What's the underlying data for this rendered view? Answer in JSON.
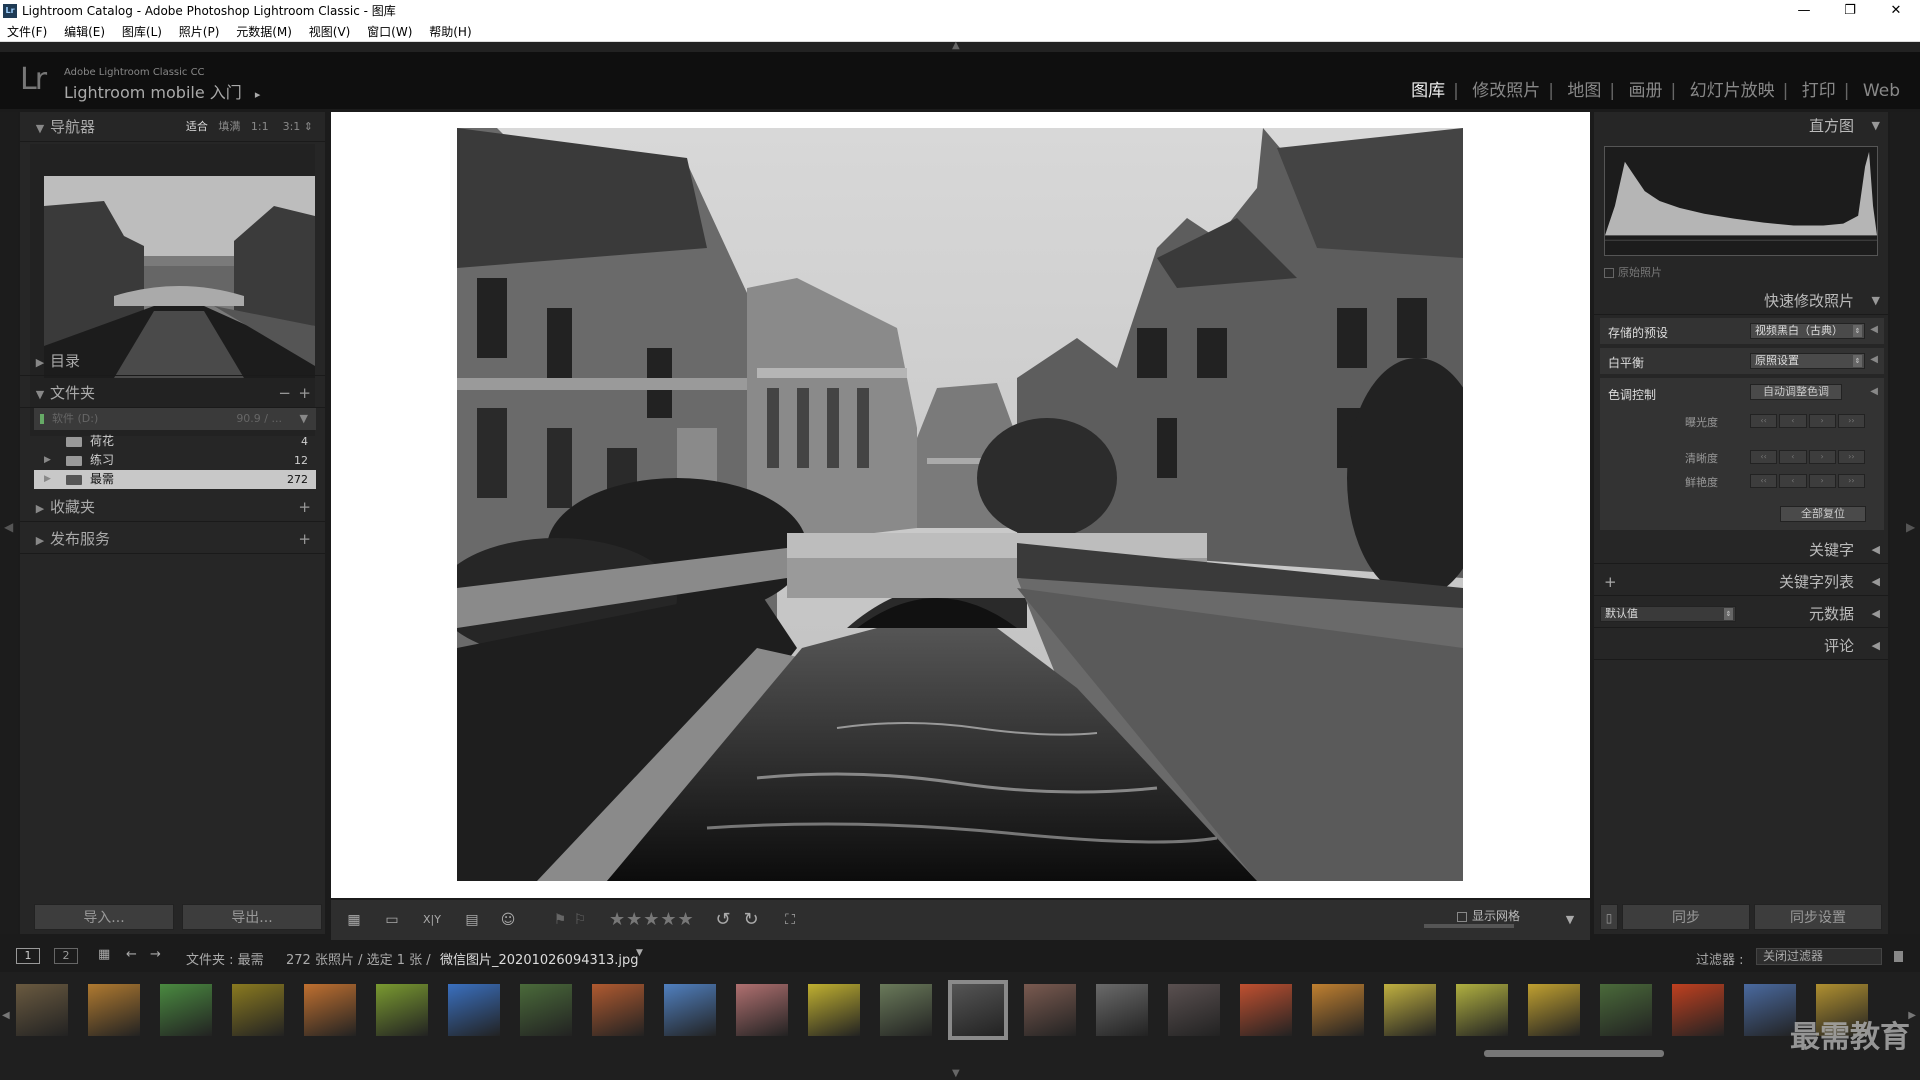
{
  "window": {
    "title": "Lightroom Catalog - Adobe Photoshop Lightroom Classic - 图库",
    "minimize": "—",
    "maximize": "❐",
    "close": "✕"
  },
  "menu": [
    "文件(F)",
    "编辑(E)",
    "图库(L)",
    "照片(P)",
    "元数据(M)",
    "视图(V)",
    "窗口(W)",
    "帮助(H)"
  ],
  "identity": {
    "logo": "Lr",
    "product": "Adobe Lightroom Classic CC",
    "mobile": "Lightroom mobile 入门",
    "arrow": "▸"
  },
  "modules": [
    "图库",
    "修改照片",
    "地图",
    "画册",
    "幻灯片放映",
    "打印",
    "Web"
  ],
  "modules_sep": "|",
  "left": {
    "navigator": {
      "title": "导航器",
      "options": [
        "适合",
        "填满",
        "1:1",
        "3:1"
      ],
      "spin": "⇕"
    },
    "catalog": "目录",
    "folders": {
      "title": "文件夹",
      "minus": "−",
      "plus": "+",
      "volume": "软件 (D:)",
      "volume_size": "90.9 / ...",
      "items": [
        {
          "name": "荷花",
          "count": "4"
        },
        {
          "name": "练习",
          "count": "12"
        },
        {
          "name": "最需",
          "count": "272"
        }
      ]
    },
    "collections": "收藏夹",
    "publish": "发布服务",
    "import": "导入...",
    "export": "导出..."
  },
  "toolbar": {
    "stars": "★★★★★",
    "show_grid": "显示网格"
  },
  "right": {
    "histogram": "直方图",
    "original": "原始照片",
    "quick_develop": "快速修改照片",
    "saved_preset_label": "存储的预设",
    "saved_preset_value": "视频黑白（古典）",
    "white_balance_label": "白平衡",
    "white_balance_value": "原照设置",
    "tone_label": "色调控制",
    "auto_tone": "自动调整色调",
    "exposure": "曝光度",
    "clarity": "清晰度",
    "vibrance": "鲜艳度",
    "reset_all": "全部复位",
    "keywording": "关键字",
    "keyword_list": "关键字列表",
    "metadata_preset": "默认值",
    "metadata": "元数据",
    "comments": "评论",
    "sync": "同步",
    "sync_settings": "同步设置"
  },
  "filmstrip_bar": {
    "views": [
      "1",
      "2"
    ],
    "source": "文件夹 : 最需",
    "info": "272 张照片 / 选定 1 张 / ",
    "filename": "微信图片_20201026094313.jpg",
    "filter_label": "过滤器 :",
    "filter_value": "关闭过滤器"
  },
  "thumb_colors": [
    "#6a5a40",
    "#b07a30",
    "#4a8a40",
    "#8a7a20",
    "#c07030",
    "#7a9a30",
    "#3a70c0",
    "#4a6a3a",
    "#b05a30",
    "#5080c0",
    "#b07070",
    "#c0b030",
    "#6a7a5a",
    "#555555",
    "#7a5a50",
    "#6a6a6a",
    "#5a5050",
    "#c05030",
    "#c08030",
    "#c0b040",
    "#b0b040",
    "#c0a030",
    "#4a6a3a",
    "#c04020",
    "#4a6aa0",
    "#b09030"
  ],
  "watermark": "最需教育"
}
